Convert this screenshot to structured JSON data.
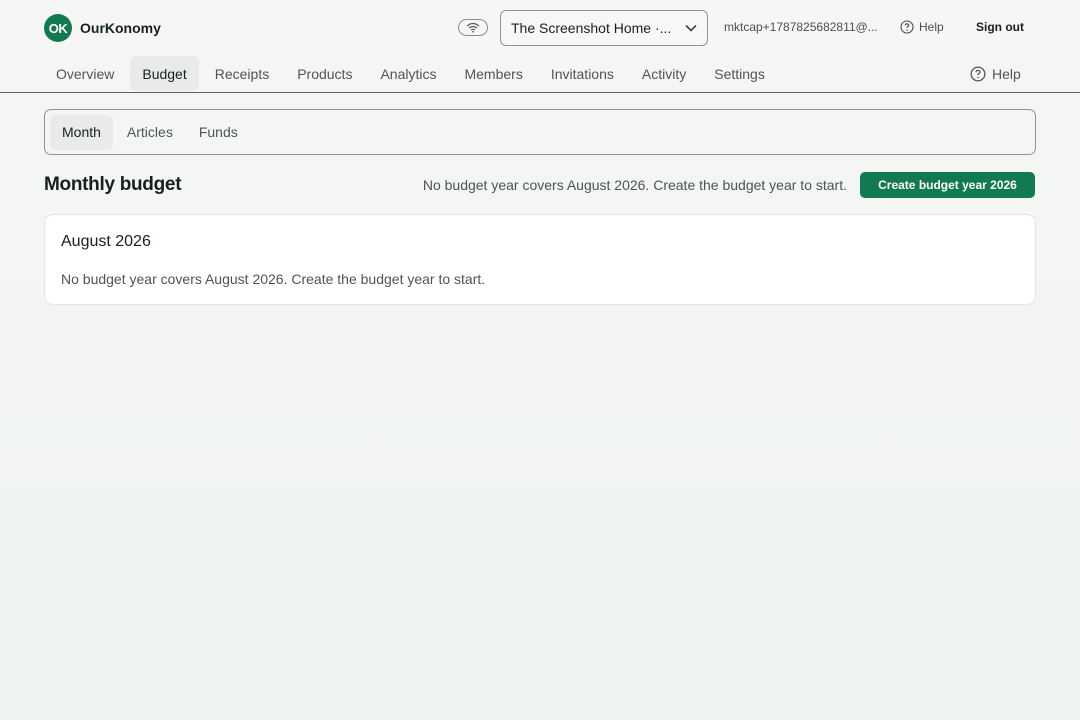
{
  "header": {
    "logo_text": "OK",
    "brand_name": "OurKonomy",
    "household_selector": "The Screenshot Home ·...",
    "user_email": "mktcap+1787825682811@...",
    "help_label": "Help",
    "signout_label": "Sign out"
  },
  "nav": {
    "tabs": [
      {
        "label": "Overview"
      },
      {
        "label": "Budget",
        "active": true
      },
      {
        "label": "Receipts"
      },
      {
        "label": "Products"
      },
      {
        "label": "Analytics"
      },
      {
        "label": "Members"
      },
      {
        "label": "Invitations"
      },
      {
        "label": "Activity"
      },
      {
        "label": "Settings"
      }
    ],
    "help_label": "Help"
  },
  "subtabs": [
    {
      "label": "Month",
      "active": true
    },
    {
      "label": "Articles"
    },
    {
      "label": "Funds"
    }
  ],
  "page": {
    "title": "Monthly budget",
    "notice": "No budget year covers August 2026. Create the budget year to start.",
    "create_button": "Create budget year 2026"
  },
  "card": {
    "title": "August 2026",
    "message": "No budget year covers August 2026. Create the budget year to start."
  },
  "colors": {
    "accent": "#127a52",
    "background": "#f2f5f2",
    "card": "#ffffff"
  }
}
